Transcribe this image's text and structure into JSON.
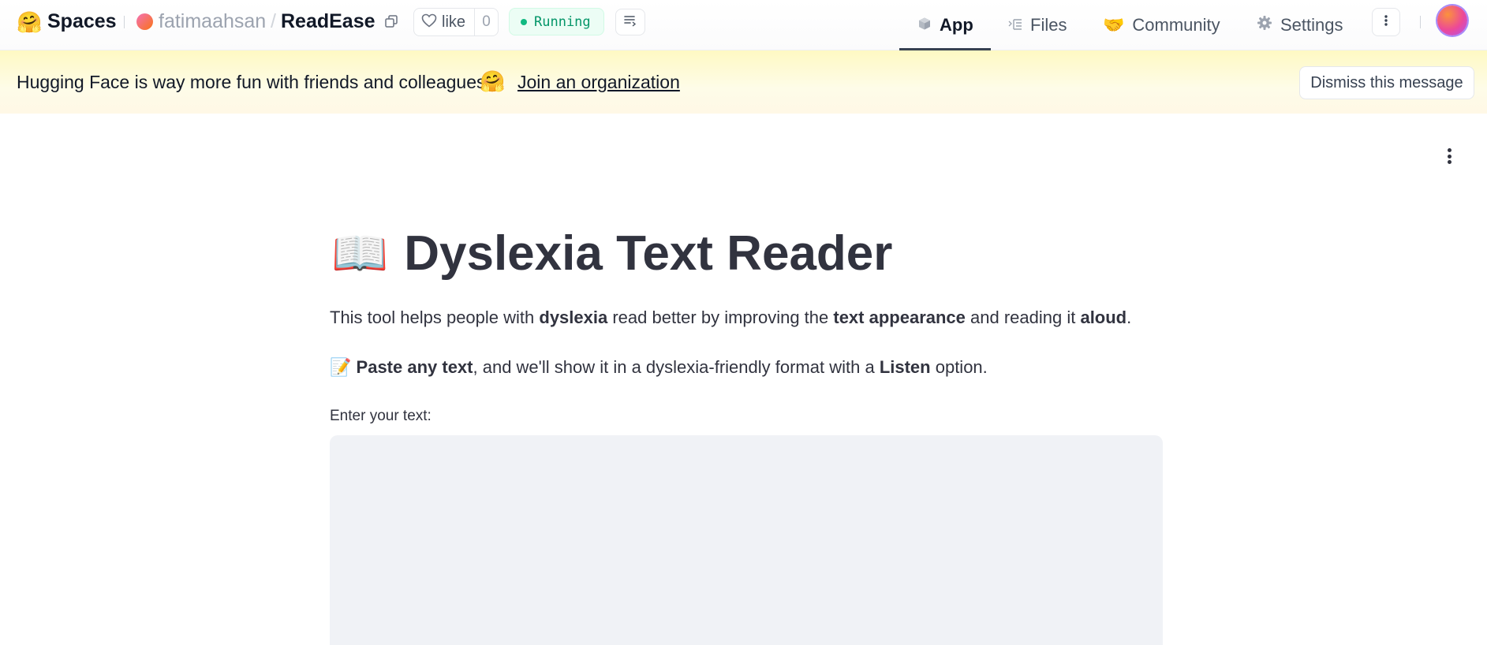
{
  "header": {
    "logo_emoji": "🤗",
    "spaces_label": "Spaces",
    "owner": "fatimaahsan",
    "separator": "/",
    "space_name": "ReadEase",
    "like_label": "like",
    "like_count": "0",
    "status": "Running",
    "tabs": [
      {
        "label": "App",
        "icon": "cube-icon",
        "active": true
      },
      {
        "label": "Files",
        "icon": "files-icon",
        "active": false
      },
      {
        "label": "Community",
        "icon": "community-icon",
        "active": false
      },
      {
        "label": "Settings",
        "icon": "gear-icon",
        "active": false
      }
    ]
  },
  "banner": {
    "message": "Hugging Face is way more fun with friends and colleagues!",
    "emoji": "🤗",
    "join_link": "Join an organization",
    "dismiss_label": "Dismiss this message"
  },
  "app": {
    "title_emoji": "📖",
    "title": "Dyslexia Text Reader",
    "description": {
      "p1": "This tool helps people with ",
      "b1": "dyslexia",
      "p2": " read better by improving the ",
      "b2": "text appearance",
      "p3": " and reading it ",
      "b3": "aloud",
      "p4": "."
    },
    "tip": {
      "emoji": "📝",
      "b1": "Paste any text",
      "p1": ", and we'll show it in a dyslexia-friendly format with a ",
      "b2": "Listen",
      "p2": " option."
    },
    "input_label": "Enter your text:",
    "input_value": ""
  },
  "colors": {
    "banner_bg": "#fef9c3",
    "running_green": "#10b981",
    "textarea_bg": "#f0f2f6",
    "text_dark": "#31333f"
  }
}
